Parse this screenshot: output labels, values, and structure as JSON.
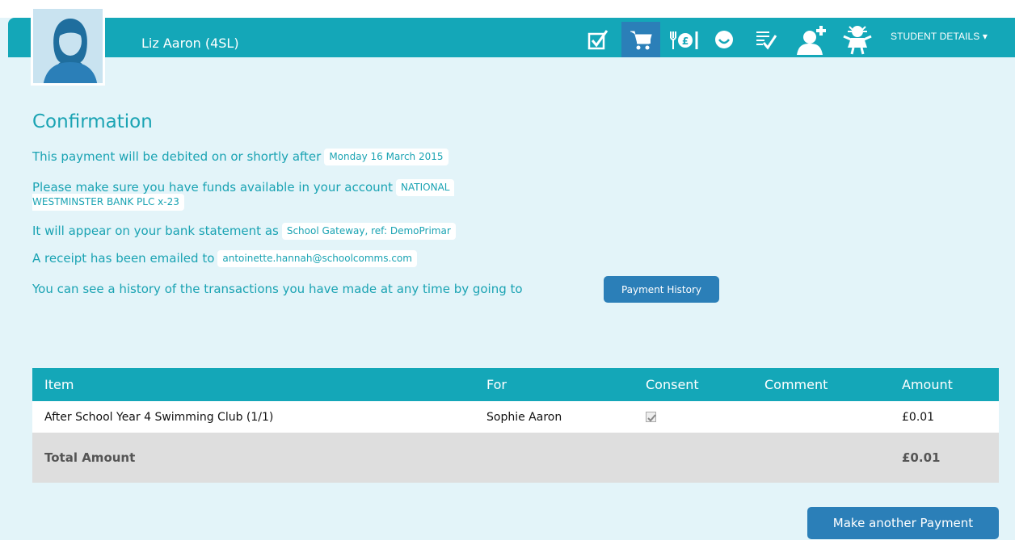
{
  "header": {
    "student_name": "Liz Aaron (4SL)",
    "student_details_label": "STUDENT DETAILS ▾",
    "icons": [
      "checkbox-icon",
      "cart-icon",
      "dinner-money-icon",
      "smiley-icon",
      "list-check-icon",
      "add-contact-icon",
      "child-icon"
    ]
  },
  "confirmation": {
    "title": "Confirmation",
    "debit_text": "This payment will be debited on or shortly after",
    "debit_date": "Monday 16 March 2015",
    "funds_text": "Please make sure you have funds available in your account",
    "account_line1": "NATIONAL",
    "account_line2": "WESTMINSTER BANK PLC x-23",
    "statement_text": "It will appear on your bank statement as",
    "statement_ref": "School Gateway, ref: DemoPrimar",
    "receipt_text": "A receipt has been emailed to",
    "receipt_email": "antoinette.hannah@schoolcomms.com",
    "history_text": "You can see a history of the transactions you have made at any time by going to",
    "history_button": "Payment History"
  },
  "table": {
    "columns": [
      "Item",
      "For",
      "Consent",
      "Comment",
      "Amount"
    ],
    "rows": [
      {
        "item": "After School Year 4 Swimming Club (1/1)",
        "for": "Sophie Aaron",
        "consent": true,
        "comment": "",
        "amount": "£0.01"
      }
    ],
    "total_label": "Total Amount",
    "total_amount": "£0.01"
  },
  "another_button": "Make another Payment",
  "colors": {
    "accent": "#14a7b8",
    "button": "#2b7fb8",
    "background": "#e3f4f9"
  }
}
